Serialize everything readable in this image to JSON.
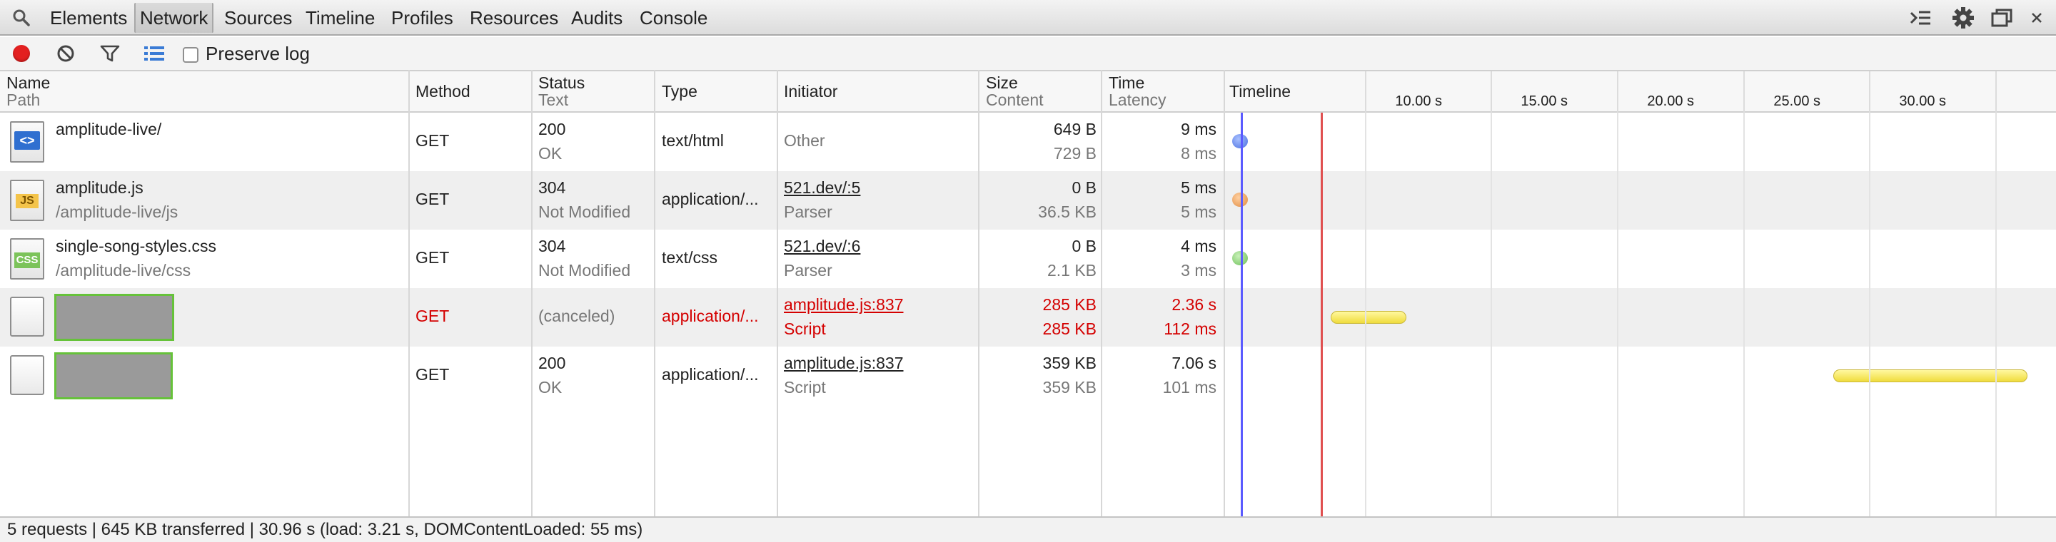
{
  "toolbar": {
    "tabs": [
      {
        "label": "Elements",
        "active": false
      },
      {
        "label": "Network",
        "active": true
      },
      {
        "label": "Sources",
        "active": false
      },
      {
        "label": "Timeline",
        "active": false
      },
      {
        "label": "Profiles",
        "active": false
      },
      {
        "label": "Resources",
        "active": false
      },
      {
        "label": "Audits",
        "active": false
      },
      {
        "label": "Console",
        "active": false
      }
    ],
    "icons": [
      "search-icon",
      "console-drawer-icon",
      "gear-icon",
      "dock-icon",
      "close-icon"
    ]
  },
  "controls": {
    "record_color": "#e32020",
    "icons": [
      "record-icon",
      "clear-icon",
      "filter-icon",
      "list-view-icon"
    ],
    "preserve_log_label": "Preserve log",
    "preserve_log_checked": false
  },
  "columns": {
    "name": {
      "label": "Name",
      "sub": "Path"
    },
    "method": {
      "label": "Method"
    },
    "status": {
      "label": "Status",
      "sub": "Text"
    },
    "type": {
      "label": "Type"
    },
    "initiator": {
      "label": "Initiator"
    },
    "size": {
      "label": "Size",
      "sub": "Content"
    },
    "time": {
      "label": "Time",
      "sub": "Latency"
    },
    "timeline": {
      "label": "Timeline"
    }
  },
  "timeline": {
    "ticks": [
      "10.00 s",
      "15.00 s",
      "20.00 s",
      "25.00 s",
      "30.00 s"
    ],
    "dom_content_loaded_color": "#5b5bff",
    "load_color": "#e05050"
  },
  "requests": [
    {
      "icon": "html-file-icon",
      "icon_label": "<>",
      "name": "amplitude-live/",
      "path": "",
      "method": "GET",
      "status": "200",
      "status_text": "OK",
      "type": "text/html",
      "initiator": "Other",
      "initiator_link": false,
      "initiator_sub": "",
      "size": "649 B",
      "content": "729 B",
      "time": "9 ms",
      "latency": "8 ms",
      "error": false,
      "redacted": false,
      "marker_color": "#6b8ff0"
    },
    {
      "icon": "js-file-icon",
      "icon_label": "JS",
      "name": "amplitude.js",
      "path": "/amplitude-live/js",
      "method": "GET",
      "status": "304",
      "status_text": "Not Modified",
      "type": "application/...",
      "initiator": "521.dev/:5",
      "initiator_link": true,
      "initiator_sub": "Parser",
      "size": "0 B",
      "content": "36.5 KB",
      "time": "5 ms",
      "latency": "5 ms",
      "error": false,
      "redacted": false,
      "marker_color": "#f0a05a"
    },
    {
      "icon": "css-file-icon",
      "icon_label": "CSS",
      "name": "single-song-styles.css",
      "path": "/amplitude-live/css",
      "method": "GET",
      "status": "304",
      "status_text": "Not Modified",
      "type": "text/css",
      "initiator": "521.dev/:6",
      "initiator_link": true,
      "initiator_sub": "Parser",
      "size": "0 B",
      "content": "2.1 KB",
      "time": "4 ms",
      "latency": "3 ms",
      "error": false,
      "redacted": false,
      "marker_color": "#88c878"
    },
    {
      "icon": "blank-file-icon",
      "icon_label": "",
      "name": "",
      "path": "",
      "method": "GET",
      "status": "(canceled)",
      "status_text": "",
      "type": "application/...",
      "initiator": "amplitude.js:837",
      "initiator_link": true,
      "initiator_sub": "Script",
      "size": "285 KB",
      "content": "285 KB",
      "time": "2.36 s",
      "latency": "112 ms",
      "error": true,
      "redacted": true,
      "marker_color": "#f0dc3c"
    },
    {
      "icon": "blank-file-icon",
      "icon_label": "",
      "name": "",
      "path": "",
      "method": "GET",
      "status": "200",
      "status_text": "OK",
      "type": "application/...",
      "initiator": "amplitude.js:837",
      "initiator_link": true,
      "initiator_sub": "Script",
      "size": "359 KB",
      "content": "359 KB",
      "time": "7.06 s",
      "latency": "101 ms",
      "error": false,
      "redacted": true,
      "marker_color": "#f0dc3c"
    }
  ],
  "status_bar": {
    "text": "5 requests | 645 KB transferred | 30.96 s (load: 3.21 s, DOMContentLoaded: 55 ms)"
  }
}
